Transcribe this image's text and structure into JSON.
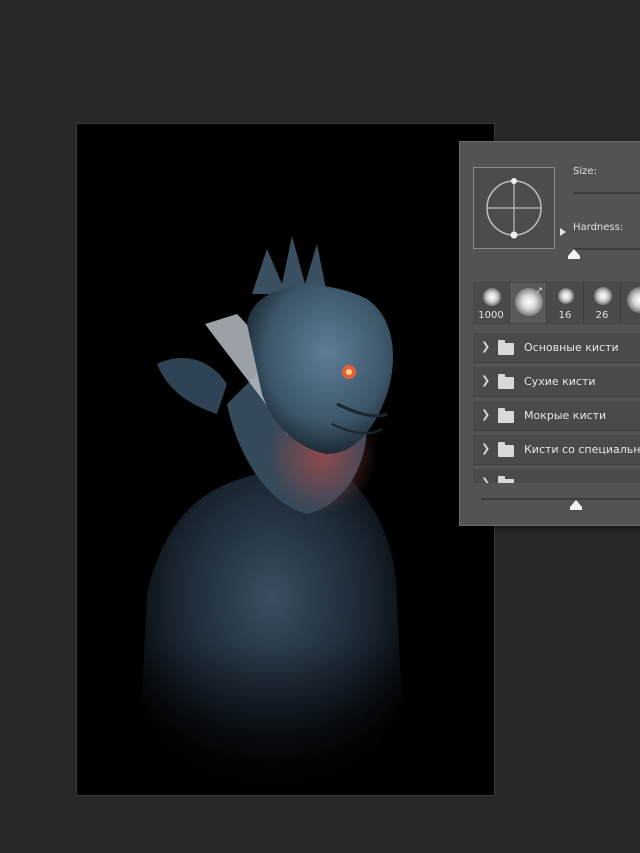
{
  "canvas": {
    "image_description_icon": "creature-bust-artwork"
  },
  "brush_panel": {
    "size_label": "Size:",
    "hardness_label": "Hardness:",
    "hardness_level": 0,
    "presets": [
      {
        "size_label": "1000"
      },
      {
        "size_label": ""
      },
      {
        "size_label": "16"
      },
      {
        "size_label": "26"
      },
      {
        "size_label": ""
      }
    ],
    "folders": [
      {
        "name": "Основные кисти"
      },
      {
        "name": "Сухие кисти"
      },
      {
        "name": "Мокрые кисти"
      },
      {
        "name": "Кисти со специальны"
      }
    ]
  }
}
